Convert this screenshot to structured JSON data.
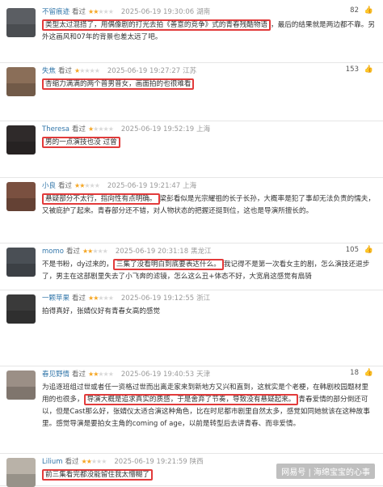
{
  "reviews": [
    {
      "user": "不留痕迹",
      "watched": "看过",
      "stars": 2,
      "date": "2025-06-19 19:30:06",
      "loc": "湖南",
      "likes": "82",
      "hl": "类型太过混搭了，用偶像剧的打光去拍《善意的竞争》式的青春残酷物语",
      "rest": "，最后的结果就是两边都不靠。另外这画风和07年的背景也差太远了吧。",
      "avatar": "#5b5e63"
    },
    {
      "user": "失焦",
      "watched": "看过",
      "stars": 1,
      "date": "2025-06-19 19:27:27",
      "loc": "江苏",
      "likes": "153",
      "hl": "杏缩力满满的两个普男普女，画面拍的也很难看",
      "rest": "",
      "avatar": "#8a6e58"
    },
    {
      "user": "Theresa",
      "watched": "看过",
      "stars": 1,
      "date": "2025-06-19 19:52:19",
      "loc": "上海",
      "likes": "",
      "hl": "男的一点演技也没 过曾",
      "rest": "",
      "avatar": "#2f2a2a"
    },
    {
      "user": "小良",
      "watched": "看过",
      "stars": 2,
      "date": "2025-06-19 19:21:47",
      "loc": "上海",
      "likes": "",
      "hl": "悬疑部分不太行，指向性有点明确。",
      "rest": "梁彭看似是光宗耀祖的长子长孙，大概率是犯了事却无法负责的懦夫，又被庇护了起来。青春部分还不错，对人物状态的把握还挺到位，这也是导演所擅长的。",
      "avatar": "#7a5040"
    },
    {
      "user": "momo",
      "watched": "看过",
      "stars": 2,
      "date": "2025-06-19 20:31:18",
      "loc": "黑龙江",
      "likes": "105",
      "pre": "不是书粉，dy过来的，",
      "hl": "三集了没看明白到底要表达什么。",
      "rest": "我记得不是第一次看女主的剧，怎么演技还退步了，男主在这部剧里失去了小飞奔的滤镜，怎么这么丑+体态不好，大宽肩这感觉有扇骑",
      "avatar": "#4a4f55"
    },
    {
      "user": "一颗苹果",
      "watched": "看过",
      "stars": 2,
      "date": "2025-06-19 19:12:55",
      "loc": "浙江",
      "likes": "",
      "pre": "拍得真好，张婧仪好有青春女高的感觉",
      "hl": "",
      "rest": "",
      "avatar": "#3a3a3a"
    },
    {
      "user": "春见野情",
      "watched": "看过",
      "stars": 2,
      "date": "2025-06-19 19:40:53",
      "loc": "天津",
      "likes": "18",
      "pre": "为追逐班组过世或者任一资格过世而出离走家来到新地方又兴和直到，这就实是个老梗，在韩剧校园题材里用的也很多，",
      "hl": "导演大概是追求真实的质感，于是舍弃了节奏，导致没有悬疑起来。",
      "rest": "青春爱情的部分倒还可以，但是Cast那么好，张婧仪太适合演这种角色，比在时尼都市剧里自然太多，感觉如同她就该在这种故事里。感觉导演是要拍女主角的coming of age，以前是转型后去讲青春、而非爱情。",
      "avatar": "#9b8f86"
    },
    {
      "user": "Lilium",
      "watched": "看过",
      "stars": 2,
      "date": "2025-06-19 19:21:59",
      "loc": "陕西",
      "likes": "",
      "hl": "前三集看完都没能留住我太懵糊了",
      "rest": "",
      "avatar": "#b9b2a8"
    }
  ],
  "watermark": "网易号 | 海绵宝宝的心事"
}
